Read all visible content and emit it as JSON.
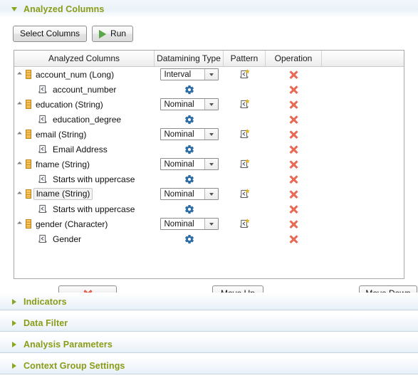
{
  "panel": {
    "title": "Analyzed Columns",
    "expanded_arrow": "triangle-down-icon"
  },
  "toolbar": {
    "select_columns_label": "Select Columns",
    "run_label": "Run",
    "run_icon": "play-icon"
  },
  "table": {
    "headers": [
      "Analyzed Columns",
      "Datamining Type",
      "Pattern",
      "Operation",
      ""
    ],
    "rows": [
      {
        "type": "column",
        "name": "account_num (Long)",
        "datamining_type": "Interval",
        "has_pattern_icon": true,
        "selected": false,
        "expander": "triangle-expanded-icon",
        "column_icon": "column-icon",
        "operation_icon": "delete-x-icon"
      },
      {
        "type": "indicator",
        "name": "account_number",
        "indicator_icon": "pattern-doc-icon",
        "has_gear": true,
        "operation_icon": "delete-x-icon"
      },
      {
        "type": "column",
        "name": "education (String)",
        "datamining_type": "Nominal",
        "has_pattern_icon": true,
        "selected": false,
        "expander": "triangle-expanded-icon",
        "column_icon": "column-icon",
        "operation_icon": "delete-x-icon"
      },
      {
        "type": "indicator",
        "name": "education_degree",
        "indicator_icon": "pattern-doc-icon",
        "has_gear": true,
        "operation_icon": "delete-x-icon"
      },
      {
        "type": "column",
        "name": "email (String)",
        "datamining_type": "Nominal",
        "has_pattern_icon": true,
        "selected": false,
        "expander": "triangle-expanded-icon",
        "column_icon": "column-icon",
        "operation_icon": "delete-x-icon"
      },
      {
        "type": "indicator",
        "name": "Email Address",
        "indicator_icon": "pattern-doc-icon",
        "has_gear": true,
        "operation_icon": "delete-x-icon"
      },
      {
        "type": "column",
        "name": "fname (String)",
        "datamining_type": "Nominal",
        "has_pattern_icon": true,
        "selected": false,
        "expander": "triangle-expanded-icon",
        "column_icon": "column-icon",
        "operation_icon": "delete-x-icon"
      },
      {
        "type": "indicator",
        "name": "Starts with uppercase",
        "indicator_icon": "pattern-doc-icon",
        "has_gear": true,
        "operation_icon": "delete-x-icon"
      },
      {
        "type": "column",
        "name": "lname (String)",
        "datamining_type": "Nominal",
        "has_pattern_icon": true,
        "selected": true,
        "expander": "triangle-expanded-icon",
        "column_icon": "column-icon",
        "operation_icon": "delete-x-icon"
      },
      {
        "type": "indicator",
        "name": "Starts with uppercase",
        "indicator_icon": "pattern-doc-icon",
        "has_gear": true,
        "operation_icon": "delete-x-icon"
      },
      {
        "type": "column",
        "name": "gender (Character)",
        "datamining_type": "Nominal",
        "has_pattern_icon": true,
        "selected": false,
        "expander": "triangle-expanded-icon",
        "column_icon": "column-icon",
        "operation_icon": "delete-x-icon"
      },
      {
        "type": "indicator",
        "name": "Gender",
        "indicator_icon": "pattern-doc-icon",
        "has_gear": true,
        "operation_icon": "delete-x-icon"
      }
    ]
  },
  "footer_buttons": {
    "delete_icon": "delete-x-icon",
    "move_up_label": "Move Up",
    "move_down_label": "Move Down"
  },
  "sections": [
    {
      "label": "Indicators",
      "expanded": false,
      "arrow": "triangle-right-icon"
    },
    {
      "label": "Data Filter",
      "expanded": false,
      "arrow": "triangle-right-icon"
    },
    {
      "label": "Analysis Parameters",
      "expanded": false,
      "arrow": "triangle-right-icon"
    },
    {
      "label": "Context Group Settings",
      "expanded": false,
      "arrow": "triangle-right-icon"
    }
  ],
  "colors": {
    "section_title": "#8a9c16",
    "delete_x": "#e8604c",
    "gear": "#2e6da4",
    "column_icon": "#e5a93a",
    "run_play": "#5aa845"
  }
}
